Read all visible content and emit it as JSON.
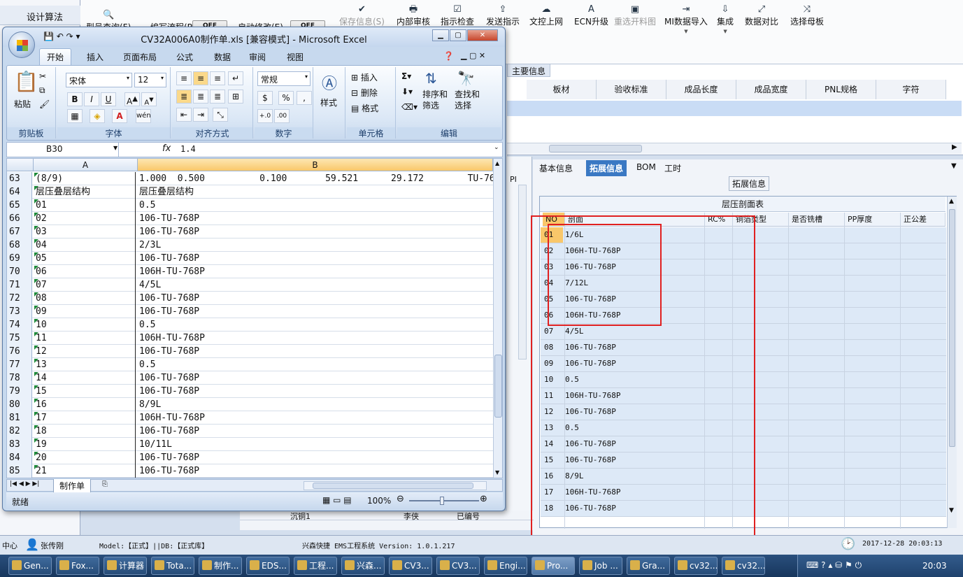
{
  "bg_app": {
    "left_nav": {
      "label": "设计算法"
    },
    "toolbar": [
      {
        "label": "型号查询(F)",
        "icon": "search-icon",
        "glyph": "🔍",
        "enabled": true
      },
      {
        "label": "编写流程(R)",
        "icon": "none",
        "glyph": "",
        "enabled": true
      },
      {
        "label": "OFF",
        "icon": "toggle",
        "glyph": "",
        "enabled": true
      },
      {
        "label": "启动修改(E)",
        "icon": "none",
        "glyph": "",
        "enabled": true
      },
      {
        "label": "OFF",
        "icon": "toggle",
        "glyph": "",
        "enabled": true
      },
      {
        "label": "保存信息(S)",
        "icon": "check-icon",
        "glyph": "✔",
        "enabled": false
      },
      {
        "label": "内部审核",
        "icon": "print-icon",
        "glyph": "🖶",
        "enabled": true
      },
      {
        "label": "指示检查",
        "icon": "checkbox-icon",
        "glyph": "☑",
        "enabled": true
      },
      {
        "label": "发送指示",
        "icon": "upload-icon",
        "glyph": "⇪",
        "enabled": true
      },
      {
        "label": "文控上网",
        "icon": "cloud-upload-icon",
        "glyph": "☁",
        "enabled": true
      },
      {
        "label": "ECN升级",
        "icon": "text-a-icon",
        "glyph": "A",
        "enabled": true
      },
      {
        "label": "重选开料图",
        "icon": "image-icon",
        "glyph": "▣",
        "enabled": false
      },
      {
        "label": "MI数据导入",
        "icon": "import-icon",
        "glyph": "⇥",
        "enabled": true,
        "dropdown": true
      },
      {
        "label": "集成",
        "icon": "download-icon",
        "glyph": "⇩",
        "enabled": true,
        "dropdown": true
      },
      {
        "label": "数据对比",
        "icon": "compare-icon",
        "glyph": "⤢",
        "enabled": true
      },
      {
        "label": "选择母板",
        "icon": "shuffle-icon",
        "glyph": "⤨",
        "enabled": true
      }
    ],
    "main_tab": "主要信息",
    "main_grid_headers": [
      "板材",
      "验收标准",
      "成品长度",
      "成品宽度",
      "PNL规格",
      "字符"
    ],
    "left_partial_label": "PI",
    "detail_tabs": [
      {
        "label": "基本信息",
        "selected": false
      },
      {
        "label": "拓展信息",
        "selected": true
      },
      {
        "label": "BOM",
        "selected": false
      },
      {
        "label": "工时",
        "selected": false
      }
    ],
    "group_title": "拓展信息",
    "grid_title": "层压剖面表",
    "grid_headers": [
      "NO",
      "剖面",
      "RC%",
      "铜箔类型",
      "是否铣槽",
      "PP厚度",
      "正公差"
    ],
    "grid_rows": [
      {
        "no": "01",
        "pm": "1/6L"
      },
      {
        "no": "02",
        "pm": "106H-TU-768P"
      },
      {
        "no": "03",
        "pm": "106-TU-768P"
      },
      {
        "no": "04",
        "pm": "7/12L"
      },
      {
        "no": "05",
        "pm": "106-TU-768P"
      },
      {
        "no": "06",
        "pm": "106H-TU-768P"
      },
      {
        "no": "07",
        "pm": "4/5L"
      },
      {
        "no": "08",
        "pm": "106-TU-768P"
      },
      {
        "no": "09",
        "pm": "106-TU-768P"
      },
      {
        "no": "10",
        "pm": "0.5"
      },
      {
        "no": "11",
        "pm": "106H-TU-768P"
      },
      {
        "no": "12",
        "pm": "106-TU-768P"
      },
      {
        "no": "13",
        "pm": "0.5"
      },
      {
        "no": "14",
        "pm": "106-TU-768P"
      },
      {
        "no": "15",
        "pm": "106-TU-768P"
      },
      {
        "no": "16",
        "pm": "8/9L"
      },
      {
        "no": "17",
        "pm": "106H-TU-768P"
      },
      {
        "no": "18",
        "pm": "106-TU-768P"
      }
    ],
    "bottom_cells": [
      "沉铜1",
      "李侠",
      "已编号"
    ],
    "status": {
      "center": "中心",
      "user": "张传刚",
      "model": "Model:【正式】||DB:【正式库】",
      "system": "兴森快捷  EMS工程系统  Version: 1.0.1.217",
      "datetime": "2017-12-28 20:03:13"
    }
  },
  "excel": {
    "title": "CV32A006A0制作单.xls  [兼容模式] - Microsoft Excel",
    "tabs": [
      "开始",
      "插入",
      "页面布局",
      "公式",
      "数据",
      "审阅",
      "视图"
    ],
    "selected_tab": "开始",
    "ribbon": {
      "paste": "粘贴",
      "clipboard": "剪贴板",
      "font_name": "宋体",
      "font_size": "12",
      "font_group": "字体",
      "align_group": "对齐方式",
      "number_format": "常规",
      "number_group": "数字",
      "styles": "样式",
      "insert": "插入",
      "delete": "删除",
      "format": "格式",
      "cells_group": "单元格",
      "sort": "排序和",
      "sort2": "筛选",
      "find": "查找和",
      "find2": "选择",
      "edit_group": "编辑",
      "percent": "%",
      "comma": ","
    },
    "name_box": "B30",
    "formula_value": "1.4",
    "col_a": "A",
    "col_b": "B",
    "rows": [
      {
        "n": "63",
        "a": "(8/9)",
        "b": "1.000  0.500          0.100       59.521      29.172        TU-768"
      },
      {
        "n": "64",
        "a": "层压叠层结构",
        "b": "层压叠层结构"
      },
      {
        "n": "65",
        "a": "01",
        "b": "0.5"
      },
      {
        "n": "66",
        "a": "02",
        "b": "106-TU-768P"
      },
      {
        "n": "67",
        "a": "03",
        "b": "106-TU-768P"
      },
      {
        "n": "68",
        "a": "04",
        "b": "2/3L"
      },
      {
        "n": "69",
        "a": "05",
        "b": "106-TU-768P"
      },
      {
        "n": "70",
        "a": "06",
        "b": "106H-TU-768P"
      },
      {
        "n": "71",
        "a": "07",
        "b": "4/5L"
      },
      {
        "n": "72",
        "a": "08",
        "b": "106-TU-768P"
      },
      {
        "n": "73",
        "a": "09",
        "b": "106-TU-768P"
      },
      {
        "n": "74",
        "a": "10",
        "b": "0.5"
      },
      {
        "n": "75",
        "a": "11",
        "b": "106H-TU-768P"
      },
      {
        "n": "76",
        "a": "12",
        "b": "106-TU-768P"
      },
      {
        "n": "77",
        "a": "13",
        "b": "0.5"
      },
      {
        "n": "78",
        "a": "14",
        "b": "106-TU-768P"
      },
      {
        "n": "79",
        "a": "15",
        "b": "106-TU-768P"
      },
      {
        "n": "80",
        "a": "16",
        "b": "8/9L"
      },
      {
        "n": "81",
        "a": "17",
        "b": "106H-TU-768P"
      },
      {
        "n": "82",
        "a": "18",
        "b": "106-TU-768P"
      },
      {
        "n": "83",
        "a": "19",
        "b": "10/11L"
      },
      {
        "n": "84",
        "a": "20",
        "b": "106-TU-768P"
      },
      {
        "n": "85",
        "a": "21",
        "b": "106-TU-768P"
      }
    ],
    "sheet_tab": "制作单",
    "status_ready": "就绪",
    "zoom": "100%"
  },
  "taskbar": {
    "items": [
      {
        "label": "Gen..."
      },
      {
        "label": "Fox..."
      },
      {
        "label": "计算器"
      },
      {
        "label": "Tota..."
      },
      {
        "label": "制作..."
      },
      {
        "label": "EDS..."
      },
      {
        "label": "工程..."
      },
      {
        "label": "兴森..."
      },
      {
        "label": "CV3..."
      },
      {
        "label": "CV3..."
      },
      {
        "label": "Engi..."
      },
      {
        "label": "Pro..."
      },
      {
        "label": "Job ..."
      },
      {
        "label": "Gra..."
      },
      {
        "label": "cv32..."
      },
      {
        "label": "cv32..."
      }
    ],
    "clock": "20:03"
  },
  "colors": {
    "highlight_red": "#e02020",
    "grid_row": "#dde9f7",
    "selected_tab": "#3a78c3",
    "title_bar": "#c5d7ee"
  }
}
